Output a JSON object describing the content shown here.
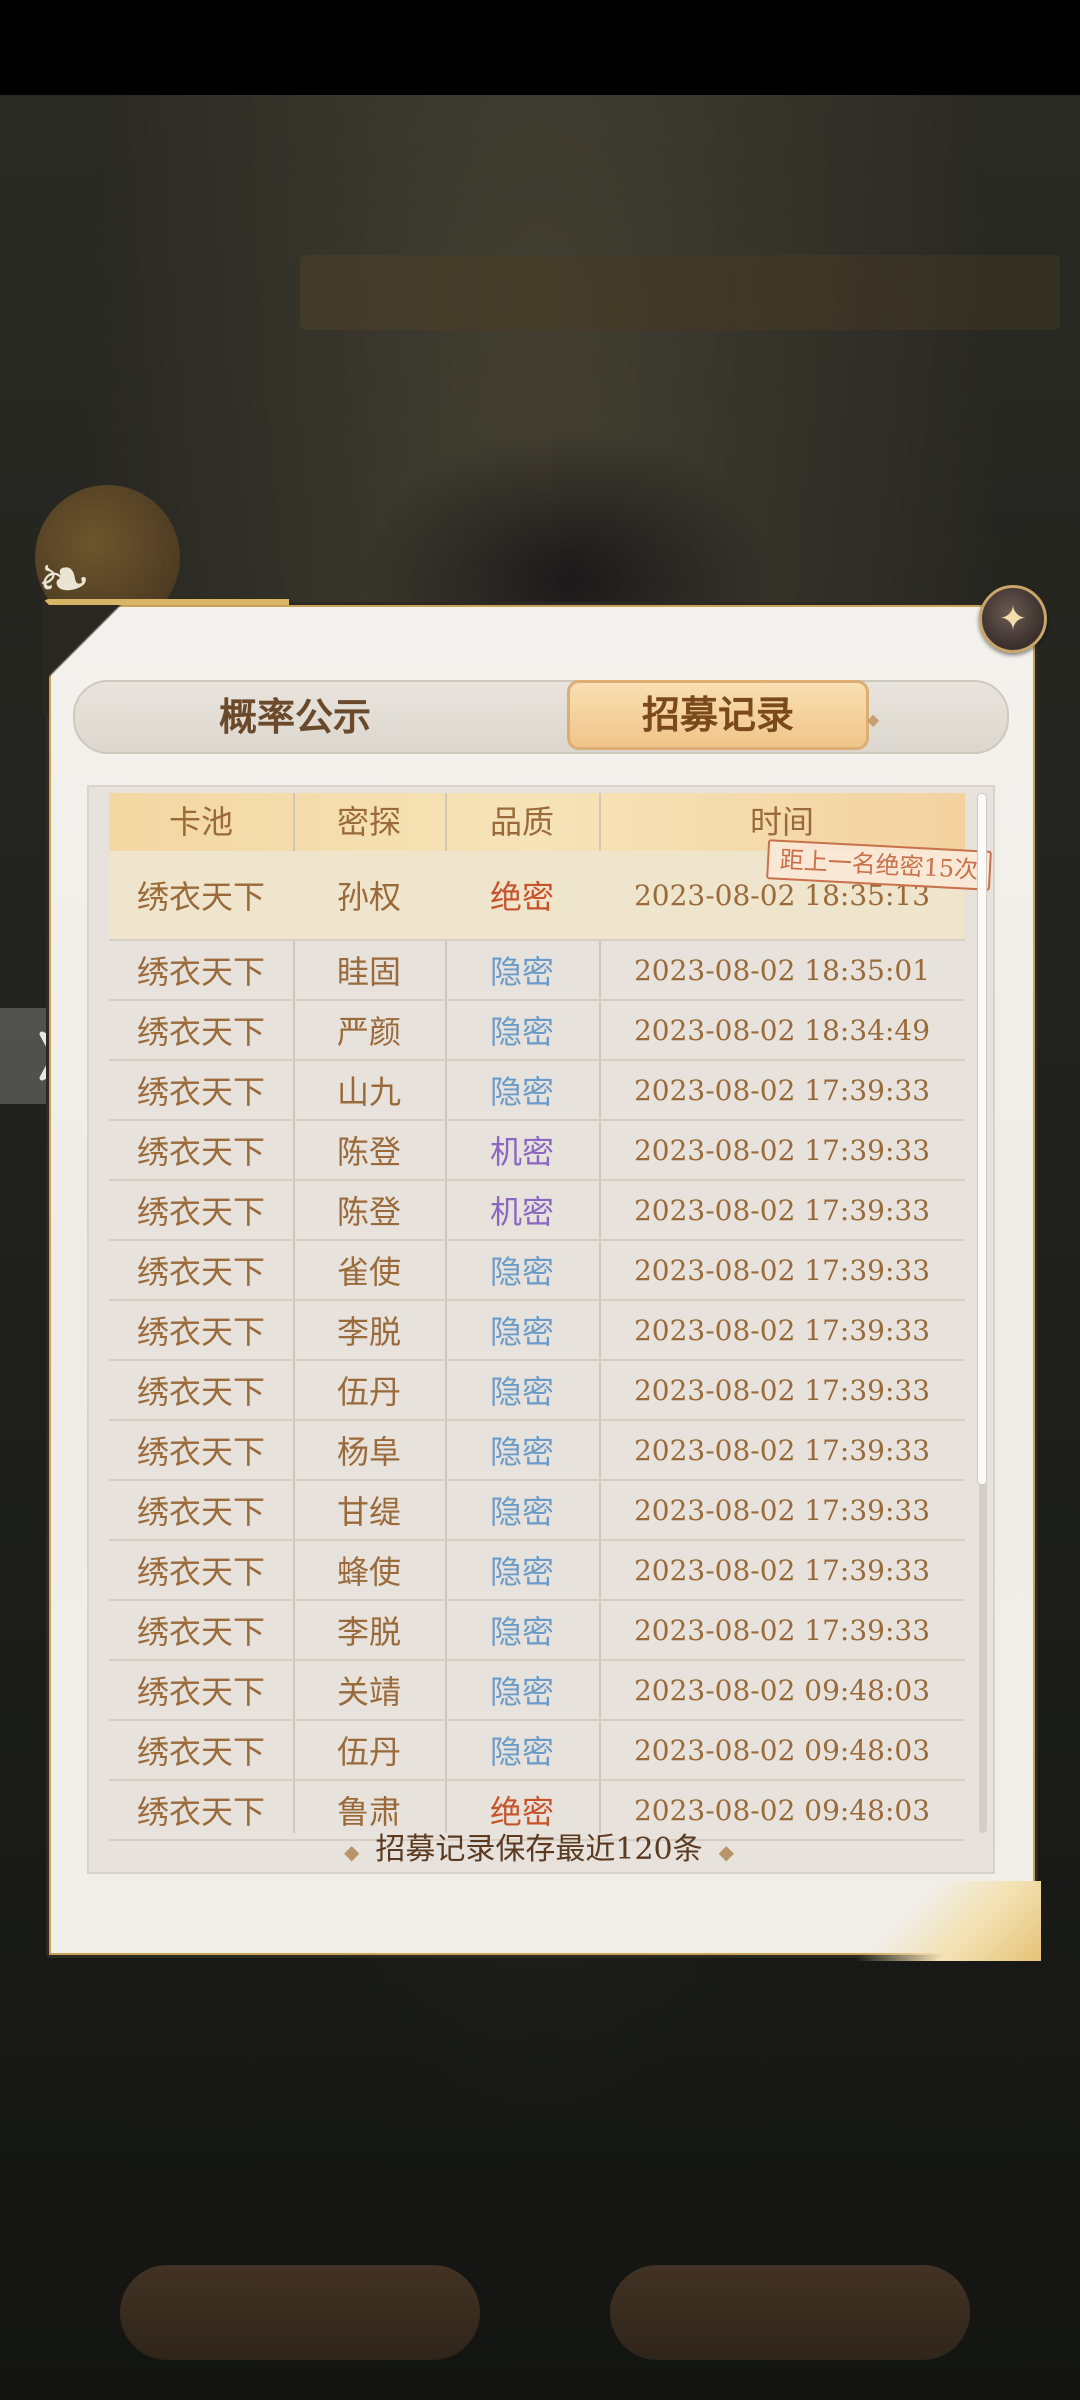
{
  "tabs": {
    "probability_label": "概率公示",
    "record_label": "招募记录"
  },
  "table": {
    "headers": {
      "pool": "卡池",
      "agent": "密探",
      "quality": "品质",
      "time": "时间"
    },
    "stamp_note": "距上一名绝密15次",
    "rows": [
      {
        "pool": "绣衣天下",
        "agent": "孙权",
        "quality": "绝密",
        "quality_tier": "jue",
        "time": "2023-08-02 18:35:13"
      },
      {
        "pool": "绣衣天下",
        "agent": "眭固",
        "quality": "隐密",
        "quality_tier": "yin",
        "time": "2023-08-02 18:35:01"
      },
      {
        "pool": "绣衣天下",
        "agent": "严颜",
        "quality": "隐密",
        "quality_tier": "yin",
        "time": "2023-08-02 18:34:49"
      },
      {
        "pool": "绣衣天下",
        "agent": "山九",
        "quality": "隐密",
        "quality_tier": "yin",
        "time": "2023-08-02 17:39:33"
      },
      {
        "pool": "绣衣天下",
        "agent": "陈登",
        "quality": "机密",
        "quality_tier": "ji",
        "time": "2023-08-02 17:39:33"
      },
      {
        "pool": "绣衣天下",
        "agent": "陈登",
        "quality": "机密",
        "quality_tier": "ji",
        "time": "2023-08-02 17:39:33"
      },
      {
        "pool": "绣衣天下",
        "agent": "雀使",
        "quality": "隐密",
        "quality_tier": "yin",
        "time": "2023-08-02 17:39:33"
      },
      {
        "pool": "绣衣天下",
        "agent": "李脱",
        "quality": "隐密",
        "quality_tier": "yin",
        "time": "2023-08-02 17:39:33"
      },
      {
        "pool": "绣衣天下",
        "agent": "伍丹",
        "quality": "隐密",
        "quality_tier": "yin",
        "time": "2023-08-02 17:39:33"
      },
      {
        "pool": "绣衣天下",
        "agent": "杨阜",
        "quality": "隐密",
        "quality_tier": "yin",
        "time": "2023-08-02 17:39:33"
      },
      {
        "pool": "绣衣天下",
        "agent": "甘缇",
        "quality": "隐密",
        "quality_tier": "yin",
        "time": "2023-08-02 17:39:33"
      },
      {
        "pool": "绣衣天下",
        "agent": "蜂使",
        "quality": "隐密",
        "quality_tier": "yin",
        "time": "2023-08-02 17:39:33"
      },
      {
        "pool": "绣衣天下",
        "agent": "李脱",
        "quality": "隐密",
        "quality_tier": "yin",
        "time": "2023-08-02 17:39:33"
      },
      {
        "pool": "绣衣天下",
        "agent": "关靖",
        "quality": "隐密",
        "quality_tier": "yin",
        "time": "2023-08-02 09:48:03"
      },
      {
        "pool": "绣衣天下",
        "agent": "伍丹",
        "quality": "隐密",
        "quality_tier": "yin",
        "time": "2023-08-02 09:48:03"
      },
      {
        "pool": "绣衣天下",
        "agent": "鲁肃",
        "quality": "绝密",
        "quality_tier": "jue",
        "time": "2023-08-02 09:48:03"
      }
    ]
  },
  "footer_note": "招募记录保存最近120条",
  "icons": {
    "close": "close-icon",
    "side_arrow": "play-arrow-icon",
    "bird": "bird-ornament-icon"
  },
  "colors": {
    "quality_jue": "#c7532a",
    "quality_yin": "#6b9bc9",
    "quality_ji": "#8b67c2",
    "tab_active_bg": "#f3cf95",
    "header_gold": "#f3d7a3"
  }
}
